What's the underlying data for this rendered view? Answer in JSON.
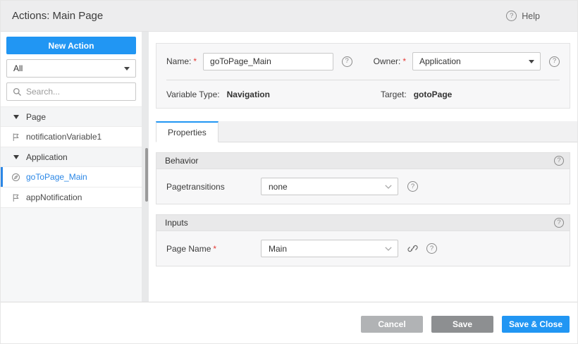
{
  "header": {
    "title": "Actions: Main Page",
    "help_label": "Help"
  },
  "sidebar": {
    "new_action_label": "New Action",
    "filter_value": "All",
    "search_placeholder": "Search...",
    "tree": [
      {
        "type": "group",
        "label": "Page"
      },
      {
        "type": "item",
        "label": "notificationVariable1",
        "icon": "flag-icon",
        "selected": false
      },
      {
        "type": "group",
        "label": "Application"
      },
      {
        "type": "item",
        "label": "goToPage_Main",
        "icon": "navigation-icon",
        "selected": true
      },
      {
        "type": "item",
        "label": "appNotification",
        "icon": "flag-icon",
        "selected": false
      }
    ]
  },
  "form": {
    "name_label": "Name:",
    "name_value": "goToPage_Main",
    "owner_label": "Owner:",
    "owner_value": "Application",
    "variable_type_label": "Variable Type:",
    "variable_type_value": "Navigation",
    "target_label": "Target:",
    "target_value": "gotoPage"
  },
  "tabs": [
    {
      "label": "Properties",
      "active": true
    }
  ],
  "sections": {
    "behavior": {
      "title": "Behavior",
      "field_label": "Pagetransitions",
      "field_value": "none",
      "required": false
    },
    "inputs": {
      "title": "Inputs",
      "field_label": "Page Name",
      "field_value": "Main",
      "required": true
    }
  },
  "footer": {
    "cancel_label": "Cancel",
    "save_label": "Save",
    "save_close_label": "Save & Close"
  },
  "ui": {
    "required_mark": "*",
    "help_glyph": "?"
  },
  "colors": {
    "accent": "#2196f3",
    "selected_text": "#2b87e6",
    "cancel_bg": "#b1b3b5",
    "save_bg": "#8d8f91",
    "required": "#e53935"
  }
}
